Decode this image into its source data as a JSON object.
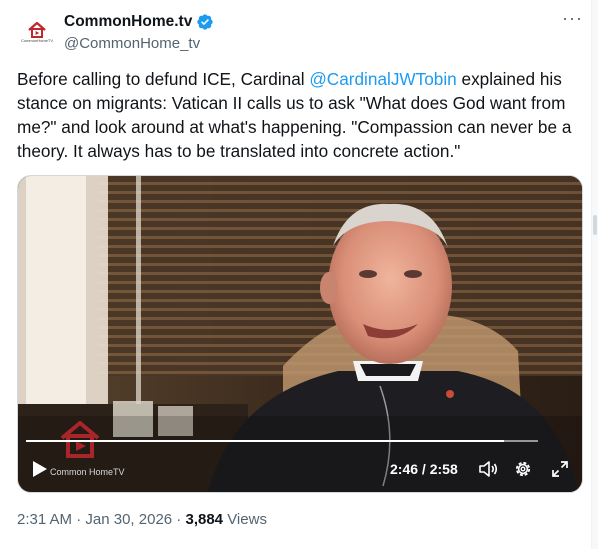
{
  "account": {
    "display_name": "CommonHome.tv",
    "handle": "@CommonHome_tv",
    "verified_icon": "verified-badge-icon",
    "avatar_caption": "CommonHomeTV"
  },
  "tweet": {
    "text_before": "Before calling to defund ICE, Cardinal ",
    "mention": "@CardinalJWTobin",
    "text_after": "  explained his stance on migrants: Vatican II calls us to ask \"What does God want from me?\" and look around at what's happening.  \"Compassion can never be a theory. It always has to be translated into concrete action.\""
  },
  "video": {
    "current_time": "2:46",
    "separator": " / ",
    "duration": "2:58",
    "progress_fraction": 0.933,
    "watermark_text": "Common HomeTV"
  },
  "meta": {
    "time": "2:31 AM",
    "dot": " · ",
    "date": "Jan 30, 2026",
    "views_count": "3,884",
    "views_label": " Views"
  },
  "colors": {
    "accent": "#1d9bf0",
    "secondary_text": "#536471",
    "brand_red": "#c0272d"
  }
}
